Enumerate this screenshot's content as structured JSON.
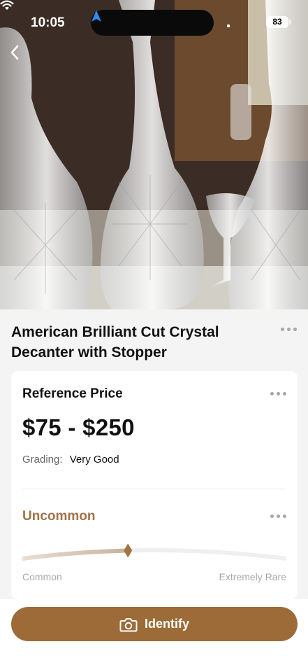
{
  "status_bar": {
    "time": "10:05",
    "battery": "83"
  },
  "item": {
    "title": "American Brilliant Cut Crystal Decanter with Stopper"
  },
  "price_card": {
    "heading": "Reference Price",
    "price": "$75 - $250",
    "grading_label": "Grading:",
    "grading_value": "Very Good"
  },
  "rarity": {
    "label": "Uncommon",
    "level": 0.4,
    "min_label": "Common",
    "max_label": "Extremely Rare"
  },
  "action": {
    "identify_label": "Identify"
  },
  "colors": {
    "accent": "#9c6b37",
    "rarity": "#a17447"
  },
  "icons": {
    "back": "chevron-left-icon",
    "more": "more-dots-icon",
    "camera": "camera-icon",
    "location": "location-arrow-icon",
    "wifi": "wifi-icon"
  }
}
